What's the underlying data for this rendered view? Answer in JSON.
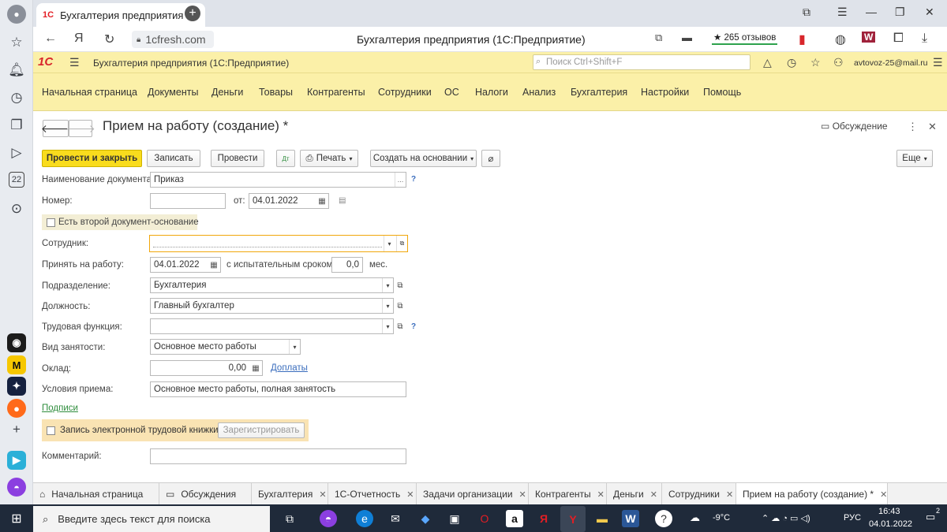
{
  "browser": {
    "tab_title": "Бухгалтерия предприятия",
    "tab_favicon": "1С",
    "url": "1cfresh.com",
    "page_title": "Бухгалтерия предприятия (1С:Предприятие)",
    "reviews": "265 отзывов",
    "sidebar_badge": "22"
  },
  "header1c": {
    "logo": "1С",
    "app_title": "Бухгалтерия предприятия (1С:Предприятие)",
    "search_placeholder": "Поиск Ctrl+Shift+F",
    "user": "avtovoz-25@mail.ru"
  },
  "menu": [
    "Начальная страница",
    "Документы",
    "Деньги",
    "Товары",
    "Контрагенты",
    "Сотрудники",
    "ОС",
    "Налоги",
    "Анализ",
    "Бухгалтерия",
    "Настройки",
    "Помощь"
  ],
  "form": {
    "title": "Прием на работу (создание) *",
    "discussion": "Обсуждение",
    "toolbar": {
      "post_close": "Провести и закрыть",
      "save": "Записать",
      "post": "Провести",
      "print": "Печать",
      "create_based": "Создать на основании",
      "more": "Еще"
    },
    "doc_name_label": "Наименование документа:",
    "doc_name_value": "Приказ",
    "number_label": "Номер:",
    "number_value": "",
    "from_label": "от:",
    "from_value": "04.01.2022",
    "second_doc_label": "Есть второй документ-основание",
    "employee_label": "Сотрудник:",
    "employee_value": "",
    "hired_label": "Принять на работу:",
    "hired_value": "04.01.2022",
    "probation_label": "с испытательным сроком:",
    "probation_value": "0,0",
    "months_label": "мес.",
    "dept_label": "Подразделение:",
    "dept_value": "Бухгалтерия",
    "position_label": "Должность:",
    "position_value": "Главный бухгалтер",
    "labor_func_label": "Трудовая функция:",
    "labor_func_value": "",
    "employment_label": "Вид занятости:",
    "employment_value": "Основное место работы",
    "salary_label": "Оклад:",
    "salary_value": "0,00",
    "allowances_link": "Доплаты",
    "conditions_label": "Условия приема:",
    "conditions_value": "Основное место работы, полная занятость",
    "signatures_link": "Подписи",
    "elabor_label": "Запись электронной трудовой книжки:",
    "register_btn": "Зарегистрировать",
    "comment_label": "Комментарий:",
    "comment_value": ""
  },
  "open_tabs": [
    "Начальная страница",
    "Обсуждения",
    "Бухгалтерия",
    "1С-Отчетность",
    "Задачи организации",
    "Контрагенты",
    "Деньги",
    "Сотрудники",
    "Прием на работу (создание) *"
  ],
  "taskbar": {
    "search_placeholder": "Введите здесь текст для поиска",
    "weather": "-9°C",
    "lang": "РУС",
    "time": "16:43",
    "date": "04.01.2022",
    "notif_count": "2"
  },
  "colors": {
    "header_yellow": "#fbf0a8",
    "primary_button": "#f9dc1d",
    "required_border": "#f1a70b",
    "link": "#3a6dbd"
  }
}
